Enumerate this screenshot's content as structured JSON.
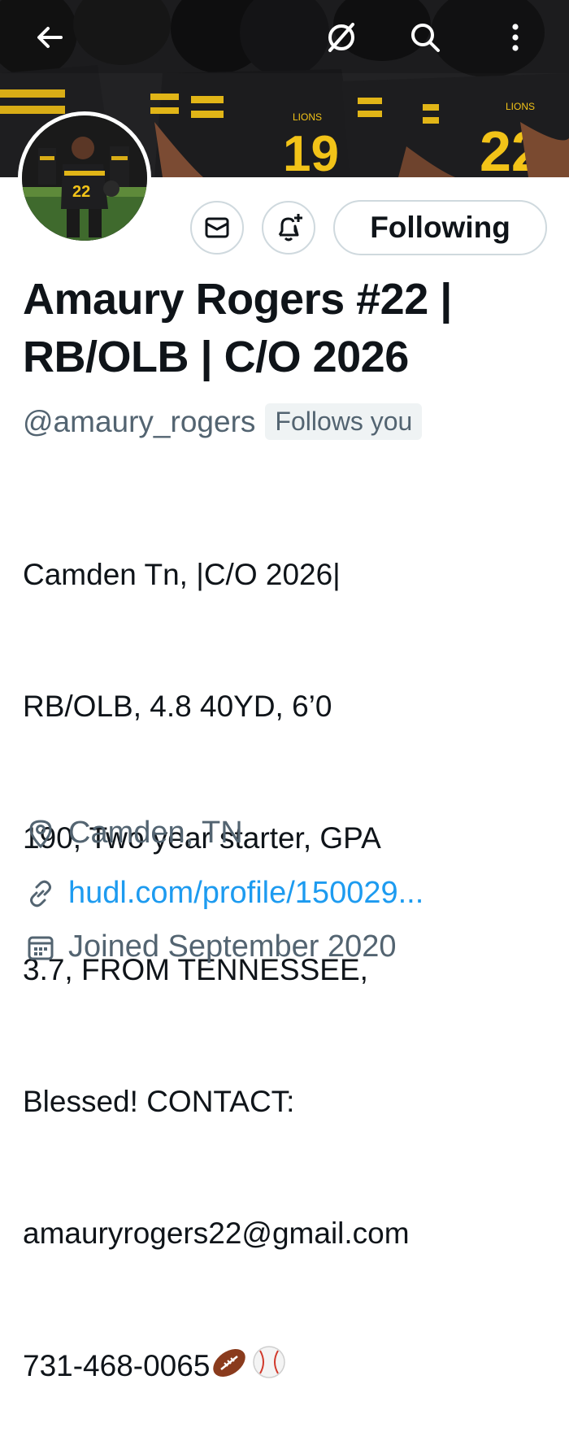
{
  "header": {
    "back_icon": "arrow-left-icon",
    "icons": [
      "slash-circle-icon",
      "search-icon",
      "more-vertical-icon"
    ]
  },
  "banner": {
    "description_players": [
      {
        "jersey_label": "LIONS",
        "number": "19"
      },
      {
        "jersey_label": "LIONS",
        "number": "22"
      }
    ]
  },
  "actions": {
    "message_icon": "mail-icon",
    "notify_icon": "bell-plus-icon",
    "follow_label": "Following"
  },
  "profile": {
    "name_line1": "Amaury Rogers #22 |",
    "name_line2": "RB/OLB | C/O 2026",
    "handle": "@amaury_rogers",
    "follows_you": "Follows you",
    "bio_lines": [
      "Camden Tn, |C/O 2026|",
      "RB/OLB, 4.8 40YD, 6’0",
      "190, Two year starter, GPA",
      "3.7, FROM TENNESSEE,",
      "Blessed! CONTACT:",
      "amauryrogers22@gmail.com",
      "731-468-0065"
    ],
    "bio_emojis": [
      "football-emoji",
      "baseball-emoji"
    ],
    "location": "Camden, TN",
    "link": "hudl.com/profile/150029...",
    "joined": "Joined September 2020"
  },
  "colors": {
    "text": "#0f1419",
    "secondary": "#536471",
    "link": "#1d9bf0",
    "border": "#cfd9de",
    "jersey_black": "#1c1c1e",
    "jersey_gold": "#f2c318"
  }
}
